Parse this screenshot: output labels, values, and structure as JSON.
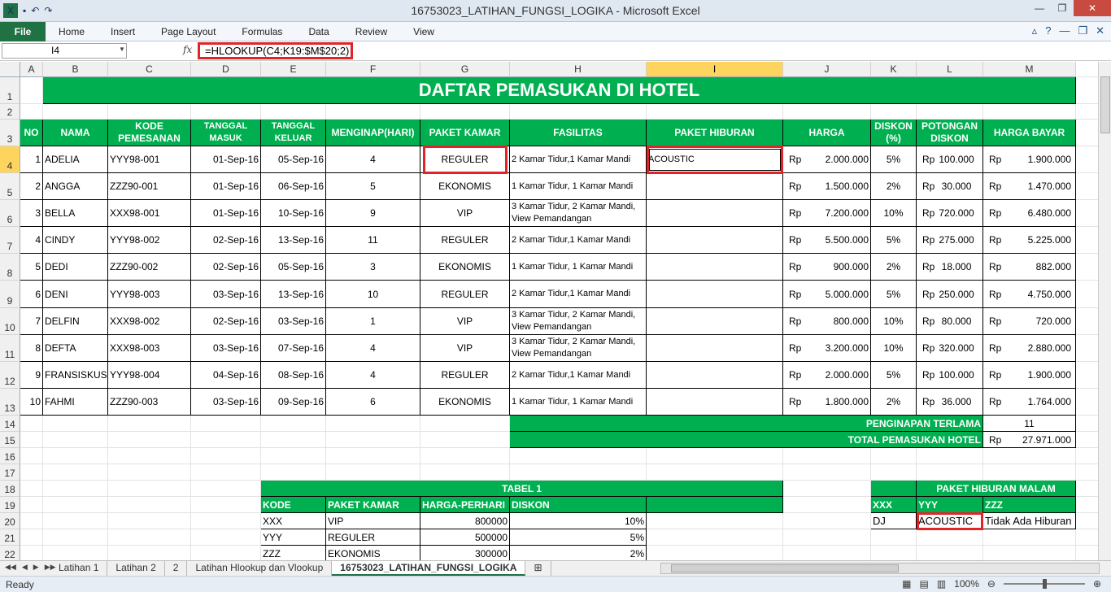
{
  "window": {
    "title": "16753023_LATIHAN_FUNGSI_LOGIKA  -  Microsoft Excel",
    "controls": [
      "minimize-icon",
      "restore-icon",
      "close-icon"
    ]
  },
  "qat": {
    "excel_glyph": "X",
    "save_glyph": "▪",
    "undo_glyph": "↶",
    "redo_glyph": "↷"
  },
  "ribbon": {
    "file_label": "File",
    "tabs": [
      "Home",
      "Insert",
      "Page Layout",
      "Formulas",
      "Data",
      "Review",
      "View"
    ],
    "help_glyph": "?"
  },
  "formula_bar": {
    "name_box": "I4",
    "fx_label": "fx",
    "formula": "=HLOOKUP(C4;K19:$M$20;2)"
  },
  "columns": [
    "A",
    "B",
    "C",
    "D",
    "E",
    "F",
    "G",
    "H",
    "I",
    "J",
    "K",
    "L",
    "M"
  ],
  "rows": [
    "1",
    "2",
    "3",
    "4",
    "5",
    "6",
    "7",
    "8",
    "9",
    "10",
    "11",
    "12",
    "13",
    "14",
    "15",
    "16",
    "17",
    "18",
    "19",
    "20",
    "21",
    "22"
  ],
  "sheet": {
    "title": "DAFTAR PEMASUKAN DI HOTEL",
    "headers": {
      "no": "NO",
      "nama": "NAMA",
      "kode": "KODE PEMESANAN",
      "tgl_masuk": "TANGGAL MASUK",
      "tgl_keluar": "TANGGAL KELUAR",
      "menginap": "MENGINAP(HARI)",
      "paket_kamar": "PAKET KAMAR",
      "fasilitas": "FASILITAS",
      "paket_hiburan": "PAKET HIBURAN",
      "harga": "HARGA",
      "diskon": "DISKON (%)",
      "potongan": "POTONGAN DISKON",
      "harga_bayar": "HARGA BAYAR"
    },
    "currency": "Rp",
    "data": [
      {
        "no": "1",
        "nama": "ADELIA",
        "kode": "YYY98-001",
        "masuk": "01-Sep-16",
        "keluar": "05-Sep-16",
        "hari": "4",
        "paket": "REGULER",
        "fasilitas": "2 Kamar Tidur,1 Kamar Mandi",
        "hiburan": "ACOUSTIC",
        "harga": "2.000.000",
        "diskon": "5%",
        "potongan": "100.000",
        "bayar": "1.900.000"
      },
      {
        "no": "2",
        "nama": "ANGGA",
        "kode": "ZZZ90-001",
        "masuk": "01-Sep-16",
        "keluar": "06-Sep-16",
        "hari": "5",
        "paket": "EKONOMIS",
        "fasilitas": "1 Kamar Tidur, 1 Kamar Mandi",
        "hiburan": "",
        "harga": "1.500.000",
        "diskon": "2%",
        "potongan": " 30.000",
        "bayar": "1.470.000"
      },
      {
        "no": "3",
        "nama": "BELLA",
        "kode": "XXX98-001",
        "masuk": "01-Sep-16",
        "keluar": "10-Sep-16",
        "hari": "9",
        "paket": "VIP",
        "fasilitas": "3 Kamar Tidur, 2 Kamar Mandi, View Pemandangan",
        "hiburan": "",
        "harga": "7.200.000",
        "diskon": "10%",
        "potongan": "720.000",
        "bayar": "6.480.000"
      },
      {
        "no": "4",
        "nama": "CINDY",
        "kode": "YYY98-002",
        "masuk": "02-Sep-16",
        "keluar": "13-Sep-16",
        "hari": "11",
        "paket": "REGULER",
        "fasilitas": "2 Kamar Tidur,1 Kamar Mandi",
        "hiburan": "",
        "harga": "5.500.000",
        "diskon": "5%",
        "potongan": "275.000",
        "bayar": "5.225.000"
      },
      {
        "no": "5",
        "nama": "DEDI",
        "kode": "ZZZ90-002",
        "masuk": "02-Sep-16",
        "keluar": "05-Sep-16",
        "hari": "3",
        "paket": "EKONOMIS",
        "fasilitas": "1 Kamar Tidur, 1 Kamar Mandi",
        "hiburan": "",
        "harga": "900.000",
        "diskon": "2%",
        "potongan": " 18.000",
        "bayar": "882.000"
      },
      {
        "no": "6",
        "nama": "DENI",
        "kode": "YYY98-003",
        "masuk": "03-Sep-16",
        "keluar": "13-Sep-16",
        "hari": "10",
        "paket": "REGULER",
        "fasilitas": "2 Kamar Tidur,1 Kamar Mandi",
        "hiburan": "",
        "harga": "5.000.000",
        "diskon": "5%",
        "potongan": "250.000",
        "bayar": "4.750.000"
      },
      {
        "no": "7",
        "nama": "DELFIN",
        "kode": "XXX98-002",
        "masuk": "02-Sep-16",
        "keluar": "03-Sep-16",
        "hari": "1",
        "paket": "VIP",
        "fasilitas": "3 Kamar Tidur, 2 Kamar Mandi, View Pemandangan",
        "hiburan": "",
        "harga": "800.000",
        "diskon": "10%",
        "potongan": " 80.000",
        "bayar": "720.000"
      },
      {
        "no": "8",
        "nama": "DEFTA",
        "kode": "XXX98-003",
        "masuk": "03-Sep-16",
        "keluar": "07-Sep-16",
        "hari": "4",
        "paket": "VIP",
        "fasilitas": "3 Kamar Tidur, 2 Kamar Mandi, View Pemandangan",
        "hiburan": "",
        "harga": "3.200.000",
        "diskon": "10%",
        "potongan": "320.000",
        "bayar": "2.880.000"
      },
      {
        "no": "9",
        "nama": "FRANSISKUS",
        "kode": "YYY98-004",
        "masuk": "04-Sep-16",
        "keluar": "08-Sep-16",
        "hari": "4",
        "paket": "REGULER",
        "fasilitas": "2 Kamar Tidur,1 Kamar Mandi",
        "hiburan": "",
        "harga": "2.000.000",
        "diskon": "5%",
        "potongan": "100.000",
        "bayar": "1.900.000"
      },
      {
        "no": "10",
        "nama": "FAHMI",
        "kode": "ZZZ90-003",
        "masuk": "03-Sep-16",
        "keluar": "09-Sep-16",
        "hari": "6",
        "paket": "EKONOMIS",
        "fasilitas": "1 Kamar Tidur, 1 Kamar Mandi",
        "hiburan": "",
        "harga": "1.800.000",
        "diskon": "2%",
        "potongan": " 36.000",
        "bayar": "1.764.000"
      }
    ],
    "summary": {
      "terlama_label": "PENGINAPAN TERLAMA",
      "terlama_value": "11",
      "total_label": "TOTAL PEMASUKAN HOTEL",
      "total_value": "27.971.000"
    },
    "tabel1": {
      "title": "TABEL 1",
      "headers": [
        "KODE",
        "PAKET KAMAR",
        "HARGA-PERHARI",
        "DISKON"
      ],
      "rows": [
        [
          "XXX",
          "VIP",
          "800000",
          "10%"
        ],
        [
          "YYY",
          "REGULER",
          "500000",
          "5%"
        ],
        [
          "ZZZ",
          "EKONOMIS",
          "300000",
          "2%"
        ]
      ]
    },
    "hiburan_table": {
      "title": "PAKET HIBURAN MALAM",
      "headers": [
        "XXX",
        "YYY",
        "ZZZ"
      ],
      "values": [
        "DJ",
        "ACOUSTIC",
        "Tidak Ada Hiburan"
      ]
    }
  },
  "sheet_tabs": [
    "Latihan 1",
    "Latihan 2",
    "2",
    "Latihan Hlookup dan Vlookup",
    "16753023_LATIHAN_FUNGSI_LOGIKA"
  ],
  "status": {
    "ready": "Ready",
    "zoom": "100%"
  }
}
